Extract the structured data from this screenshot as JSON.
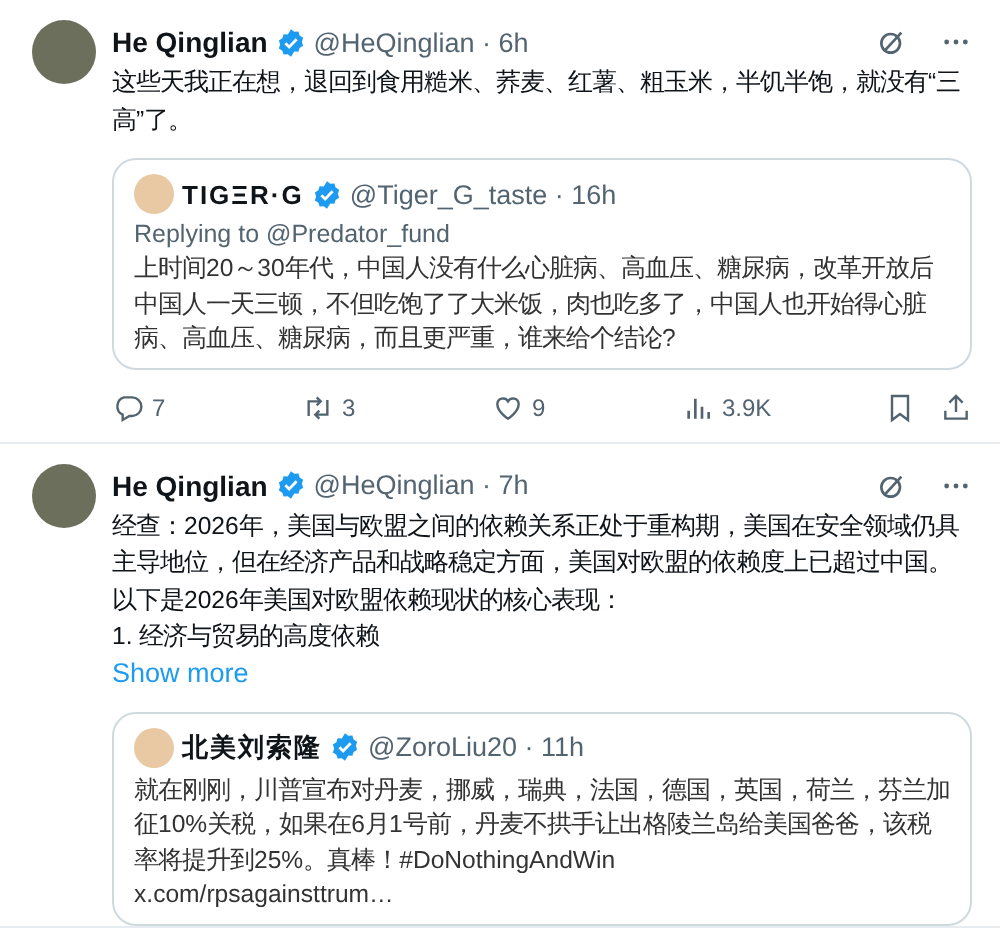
{
  "tweets": [
    {
      "author": "He Qinglian",
      "verified": true,
      "meta": "@HeQinglian · 6h",
      "paragraphs": [
        "这些天我正在想，退回到食用糙米、荞麦、红薯、粗玉米，半饥半饱，就没有“三高”了。"
      ],
      "quote": {
        "author": "TIGΞR·G",
        "verified": true,
        "meta": "@Tiger_G_taste · 16h",
        "replying_to": "Replying to @Predator_fund",
        "text": "上时间20～30年代，中国人没有什么心脏病、高血压、糖尿病，改革开放后中国人一天三顿，不但吃饱了了大米饭，肉也吃多了，中国人也开始得心脏病、高血压、糖尿病，而且更严重，谁来给个结论?"
      },
      "actions": [
        {
          "kind": "reply",
          "count": "7"
        },
        {
          "kind": "repost",
          "count": "3"
        },
        {
          "kind": "like",
          "count": "9"
        },
        {
          "kind": "views",
          "count": "3.9K"
        },
        {
          "kind": "bookmark"
        },
        {
          "kind": "share"
        }
      ]
    },
    {
      "author": "He Qinglian",
      "verified": true,
      "meta": "@HeQinglian · 7h",
      "paragraphs": [
        "经查：2026年，美国与欧盟之间的依赖关系正处于重构期，美国在安全领域仍具主导地位，但在经济产品和战略稳定方面，美国对欧盟的依赖度上已超过中国。",
        "以下是2026年美国对欧盟依赖现状的核心表现：",
        "1. 经济与贸易的高度依赖"
      ],
      "show_more": "Show more",
      "quote": {
        "author": "北美刘索隆",
        "verified": true,
        "meta": "@ZoroLiu20 · 11h",
        "text": "就在刚刚，川普宣布对丹麦，挪威，瑞典，法国，德国，英国，荷兰，芬兰加征10%关税，如果在6月1号前，丹麦不拱手让出格陵兰岛给美国爸爸，该税率将提升到25%。真棒！#DoNothingAndWin",
        "link": "x.com/rpsagainsttrum…"
      }
    }
  ]
}
